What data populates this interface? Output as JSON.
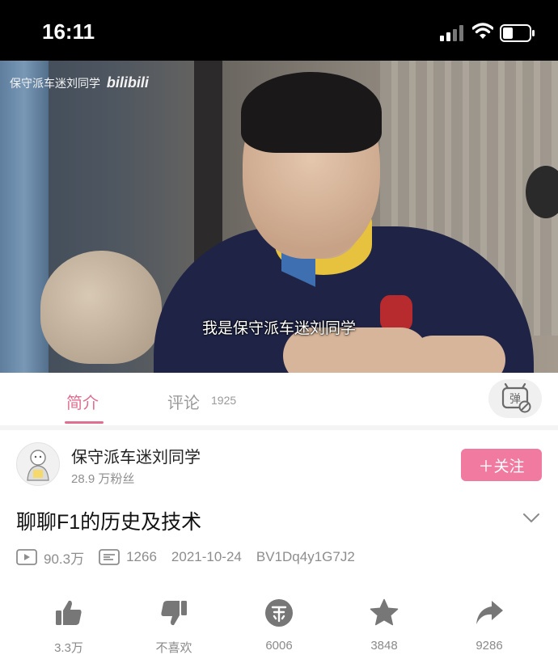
{
  "status_bar": {
    "time": "16:11"
  },
  "video": {
    "watermark_channel": "保守派车迷刘同学",
    "watermark_logo": "bilibili",
    "subtitle": "我是保守派车迷刘同学"
  },
  "tabs": {
    "intro_label": "简介",
    "comments_label": "评论",
    "comments_count": "1925",
    "danmaku_icon_text": "弹"
  },
  "author": {
    "name": "保守派车迷刘同学",
    "followers": "28.9 万粉丝",
    "follow_label": "＋关注"
  },
  "video_info": {
    "title": "聊聊F1的历史及技术",
    "views": "90.3万",
    "danmaku_count": "1266",
    "date": "2021-10-24",
    "bvid": "BV1Dq4y1G7J2"
  },
  "actions": {
    "like": "3.3万",
    "dislike": "不喜欢",
    "coin": "6006",
    "favorite": "3848",
    "share": "9286"
  },
  "colors": {
    "accent_pink": "#f17aa0",
    "tab_active": "#e06e90"
  },
  "icons": [
    "signal-icon",
    "wifi-icon",
    "battery-icon",
    "danmaku-toggle-icon",
    "play-count-icon",
    "danmaku-count-icon",
    "chevron-down-icon",
    "like-icon",
    "dislike-icon",
    "coin-icon",
    "star-icon",
    "share-icon"
  ]
}
